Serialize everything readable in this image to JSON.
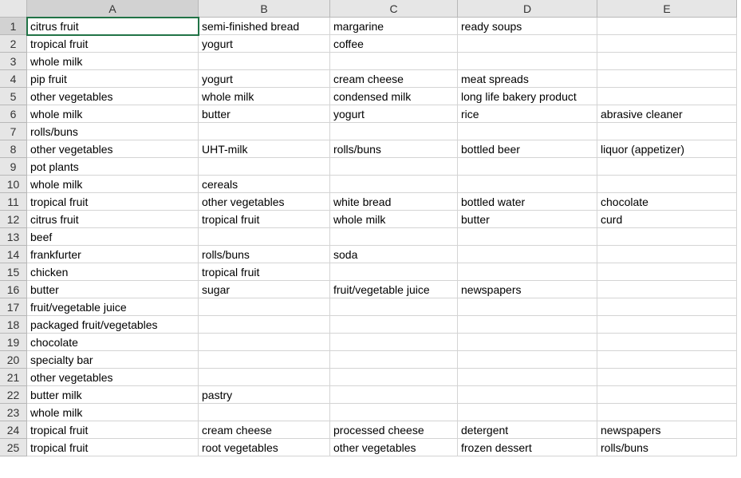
{
  "columns": [
    "A",
    "B",
    "C",
    "D",
    "E"
  ],
  "selected_cell": "A1",
  "rows": [
    {
      "num": 1,
      "cells": [
        "citrus fruit",
        "semi-finished bread",
        "margarine",
        "ready soups",
        ""
      ]
    },
    {
      "num": 2,
      "cells": [
        "tropical fruit",
        "yogurt",
        "coffee",
        "",
        ""
      ]
    },
    {
      "num": 3,
      "cells": [
        "whole milk",
        "",
        "",
        "",
        ""
      ]
    },
    {
      "num": 4,
      "cells": [
        "pip fruit",
        "yogurt",
        "cream cheese",
        "meat spreads",
        ""
      ]
    },
    {
      "num": 5,
      "cells": [
        "other vegetables",
        "whole milk",
        "condensed milk",
        "long life bakery product",
        ""
      ]
    },
    {
      "num": 6,
      "cells": [
        "whole milk",
        "butter",
        "yogurt",
        "rice",
        "abrasive cleaner"
      ]
    },
    {
      "num": 7,
      "cells": [
        "rolls/buns",
        "",
        "",
        "",
        ""
      ]
    },
    {
      "num": 8,
      "cells": [
        "other vegetables",
        "UHT-milk",
        "rolls/buns",
        "bottled beer",
        "liquor (appetizer)"
      ]
    },
    {
      "num": 9,
      "cells": [
        "pot plants",
        "",
        "",
        "",
        ""
      ]
    },
    {
      "num": 10,
      "cells": [
        "whole milk",
        "cereals",
        "",
        "",
        ""
      ]
    },
    {
      "num": 11,
      "cells": [
        "tropical fruit",
        "other vegetables",
        "white bread",
        "bottled water",
        "chocolate"
      ]
    },
    {
      "num": 12,
      "cells": [
        "citrus fruit",
        "tropical fruit",
        "whole milk",
        "butter",
        "curd"
      ]
    },
    {
      "num": 13,
      "cells": [
        "beef",
        "",
        "",
        "",
        ""
      ]
    },
    {
      "num": 14,
      "cells": [
        "frankfurter",
        "rolls/buns",
        "soda",
        "",
        ""
      ]
    },
    {
      "num": 15,
      "cells": [
        "chicken",
        "tropical fruit",
        "",
        "",
        ""
      ]
    },
    {
      "num": 16,
      "cells": [
        "butter",
        "sugar",
        "fruit/vegetable juice",
        "newspapers",
        ""
      ]
    },
    {
      "num": 17,
      "cells": [
        "fruit/vegetable juice",
        "",
        "",
        "",
        ""
      ]
    },
    {
      "num": 18,
      "cells": [
        "packaged fruit/vegetables",
        "",
        "",
        "",
        ""
      ]
    },
    {
      "num": 19,
      "cells": [
        "chocolate",
        "",
        "",
        "",
        ""
      ]
    },
    {
      "num": 20,
      "cells": [
        "specialty bar",
        "",
        "",
        "",
        ""
      ]
    },
    {
      "num": 21,
      "cells": [
        "other vegetables",
        "",
        "",
        "",
        ""
      ]
    },
    {
      "num": 22,
      "cells": [
        "butter milk",
        "pastry",
        "",
        "",
        ""
      ]
    },
    {
      "num": 23,
      "cells": [
        "whole milk",
        "",
        "",
        "",
        ""
      ]
    },
    {
      "num": 24,
      "cells": [
        "tropical fruit",
        "cream cheese",
        "processed cheese",
        "detergent",
        "newspapers"
      ]
    },
    {
      "num": 25,
      "cells": [
        "tropical fruit",
        "root vegetables",
        "other vegetables",
        "frozen dessert",
        "rolls/buns"
      ]
    }
  ]
}
